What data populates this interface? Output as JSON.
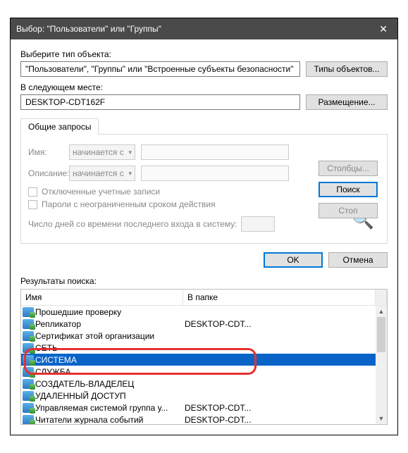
{
  "title": "Выбор: \"Пользователи\" или \"Группы\"",
  "sec1": {
    "label": "Выберите тип объекта:",
    "value": "\"Пользователи\", \"Группы\" или \"Встроенные субъекты безопасности\"",
    "btn": "Типы объектов..."
  },
  "sec2": {
    "label": "В следующем месте:",
    "value": "DESKTOP-CDT162F",
    "btn": "Размещение..."
  },
  "tab": "Общие запросы",
  "fName": {
    "label": "Имя:",
    "op": "начинается с"
  },
  "fDesc": {
    "label": "Описание:",
    "op": "начинается с"
  },
  "chk1": "Отключенные учетные записи",
  "chk2": "Пароли с неограниченным сроком действия",
  "lastLogon": "Число дней со времени последнего входа в систему:",
  "side": {
    "cols": "Столбцы...",
    "find": "Поиск",
    "stop": "Стоп"
  },
  "ok": "OK",
  "cancel": "Отмена",
  "resLabel": "Результаты поиска:",
  "cols": {
    "name": "Имя",
    "folder": "В папке"
  },
  "rows": [
    {
      "n": "Прошедшие проверку",
      "f": ""
    },
    {
      "n": "Репликатор",
      "f": "DESKTOP-CDT..."
    },
    {
      "n": "Сертификат этой организации",
      "f": ""
    },
    {
      "n": "СЕТЬ",
      "f": ""
    },
    {
      "n": "СИСТЕМА",
      "f": ""
    },
    {
      "n": "СЛУЖБА",
      "f": ""
    },
    {
      "n": "СОЗДАТЕЛЬ-ВЛАДЕЛЕЦ",
      "f": ""
    },
    {
      "n": "УДАЛЕННЫЙ ДОСТУП",
      "f": ""
    },
    {
      "n": "Управляемая системой группа у...",
      "f": "DESKTOP-CDT..."
    },
    {
      "n": "Читатели журнала событий",
      "f": "DESKTOP-CDT..."
    }
  ],
  "selIndex": 4,
  "highlightTop": 60
}
